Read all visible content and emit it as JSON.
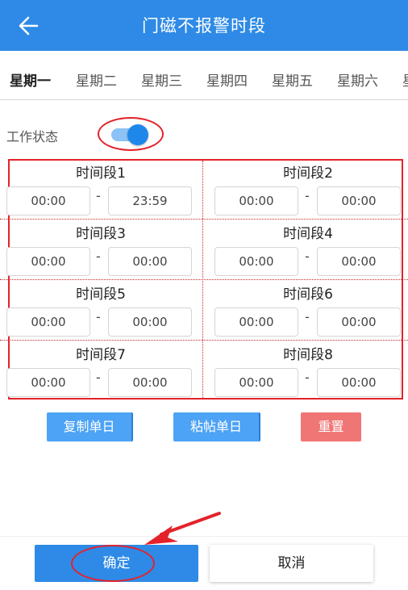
{
  "header": {
    "title": "门磁不报警时段",
    "back_icon": "arrow-left-icon"
  },
  "tabs": [
    {
      "label": "星期一",
      "active": true
    },
    {
      "label": "星期二",
      "active": false
    },
    {
      "label": "星期三",
      "active": false
    },
    {
      "label": "星期四",
      "active": false
    },
    {
      "label": "星期五",
      "active": false
    },
    {
      "label": "星期六",
      "active": false
    },
    {
      "label": "星",
      "active": false
    }
  ],
  "work_status": {
    "label": "工作状态",
    "enabled": true
  },
  "periods": [
    {
      "label": "时间段1",
      "start": "00:00",
      "end": "23:59"
    },
    {
      "label": "时间段2",
      "start": "00:00",
      "end": "00:00"
    },
    {
      "label": "时间段3",
      "start": "00:00",
      "end": "00:00"
    },
    {
      "label": "时间段4",
      "start": "00:00",
      "end": "00:00"
    },
    {
      "label": "时间段5",
      "start": "00:00",
      "end": "00:00"
    },
    {
      "label": "时间段6",
      "start": "00:00",
      "end": "00:00"
    },
    {
      "label": "时间段7",
      "start": "00:00",
      "end": "00:00"
    },
    {
      "label": "时间段8",
      "start": "00:00",
      "end": "00:00"
    }
  ],
  "separator": "-",
  "actions": {
    "copy_day": "复制单日",
    "paste_day": "粘帖单日",
    "reset": "重置"
  },
  "footer": {
    "confirm": "确定",
    "cancel": "取消"
  },
  "colors": {
    "primary": "#2e8ae6",
    "reset_button": "#f07676",
    "annotation": "#e4222a"
  }
}
